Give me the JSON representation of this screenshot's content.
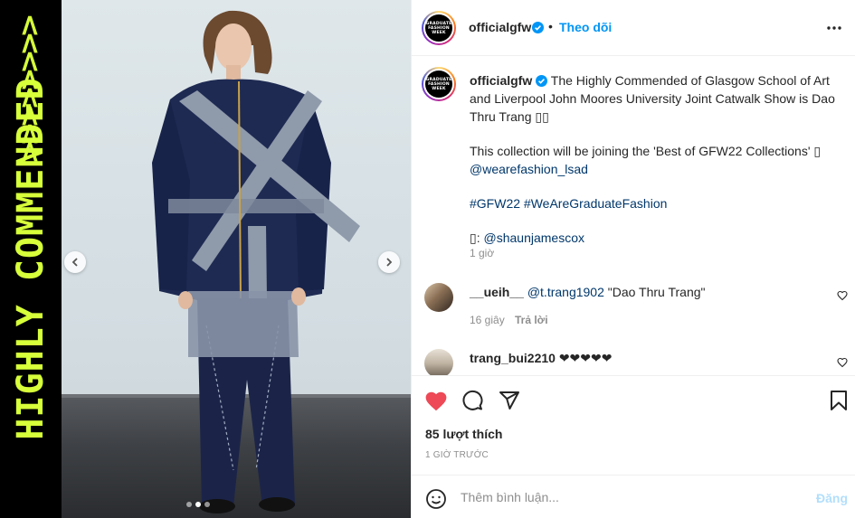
{
  "side_banner": {
    "text": "HIGHLY COMMENDED",
    "chevrons": ">>>>>>>>",
    "color": "#d7ff3a"
  },
  "photo": {
    "prev_icon": "chevron-left-icon",
    "next_icon": "chevron-right-icon",
    "slide_count": 3,
    "active_slide": 1
  },
  "header": {
    "avatar_logo": [
      "GRADUATE",
      "FASHION",
      "WEEK"
    ],
    "username": "officialgfw",
    "separator": "•",
    "follow_label": "Theo dõi",
    "more_icon": "more-horizontal-icon"
  },
  "caption": {
    "username": "officialgfw",
    "line1": "The Highly Commended of Glasgow School of Art and Liverpool John Moores University Joint Catwalk Show is Dao Thru Trang ",
    "line1_glyphs": "▯▯",
    "line2": "This collection will be joining the 'Best of GFW22 Collections' ",
    "line2_glyph": "▯",
    "mention1": "@wearefashion_lsad",
    "hashtag1": "#GFW22",
    "hashtag2": "#WeAreGraduateFashion",
    "credit_glyph": "▯",
    "credit_prefix": ": ",
    "mention2": "@shaunjamescox",
    "time": "1 giờ"
  },
  "comments": [
    {
      "username": "__ueih__",
      "mention": "@t.trang1902",
      "text": "\"Dao Thru Trang\"",
      "time": "16 giây",
      "reply_label": "Trả lời"
    },
    {
      "username": "trang_bui2210",
      "text": "❤❤❤❤❤"
    }
  ],
  "actions": {
    "liked": true,
    "like_color": "#ed4956",
    "likes_text": "85 lượt thích",
    "time_text": "1 GIỜ TRƯỚC"
  },
  "comment_box": {
    "placeholder": "Thêm bình luận...",
    "post_label": "Đăng"
  }
}
